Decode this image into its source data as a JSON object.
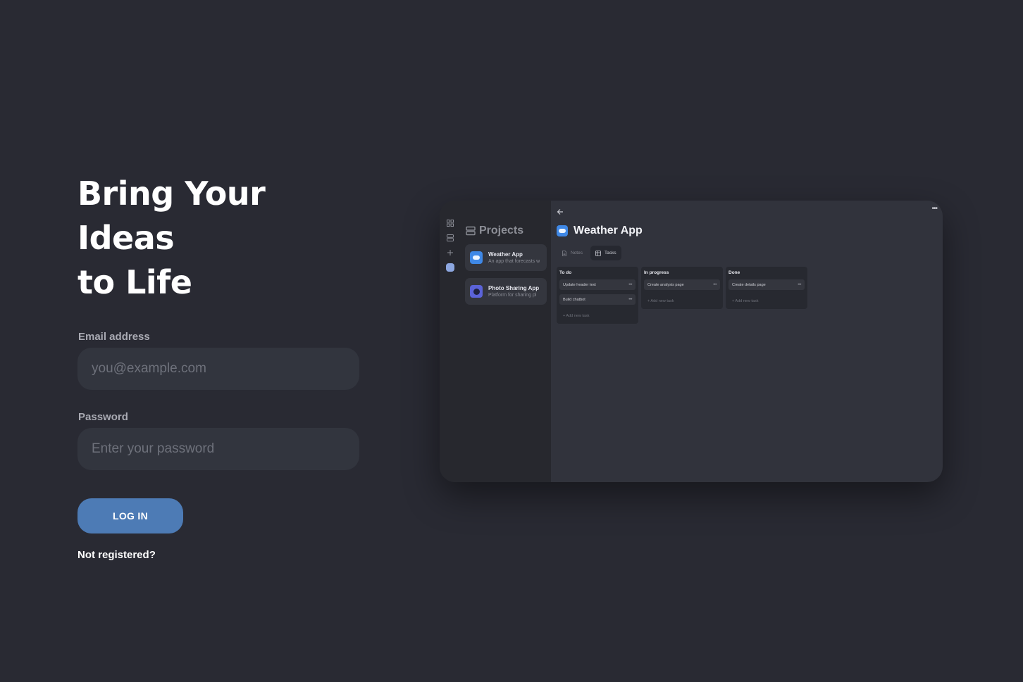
{
  "hero": {
    "headline_line1": "Bring Your Ideas",
    "headline_line2": "to Life"
  },
  "form": {
    "email_label": "Email address",
    "email_placeholder": "you@example.com",
    "password_label": "Password",
    "password_placeholder": "Enter your password",
    "login_button": "LOG IN",
    "register_link": "Not registered?"
  },
  "preview": {
    "sidebar_title": "Projects",
    "projects": [
      {
        "name": "Weather App",
        "description": "An app that forecasts w",
        "icon": "weather-cloud-icon"
      },
      {
        "name": "Photo Sharing App",
        "description": "Platform for sharing pl",
        "icon": "photo-circle-icon"
      }
    ],
    "board_title": "Weather App",
    "tabs": [
      {
        "label": "Notes",
        "icon": "document-icon",
        "active": false
      },
      {
        "label": "Tasks",
        "icon": "board-icon",
        "active": true
      }
    ],
    "columns": [
      {
        "title": "To do",
        "tasks": [
          "Update header text",
          "Build chatbot"
        ],
        "add_label": "+ Add new task"
      },
      {
        "title": "In progress",
        "tasks": [
          "Create analysis page"
        ],
        "add_label": "+ Add new task"
      },
      {
        "title": "Done",
        "tasks": [
          "Create details page"
        ],
        "add_label": "+ Add new task"
      }
    ]
  },
  "colors": {
    "background": "#292a33",
    "input_background": "#32353e",
    "accent": "#4d7bb5",
    "label": "#a9aab3"
  }
}
